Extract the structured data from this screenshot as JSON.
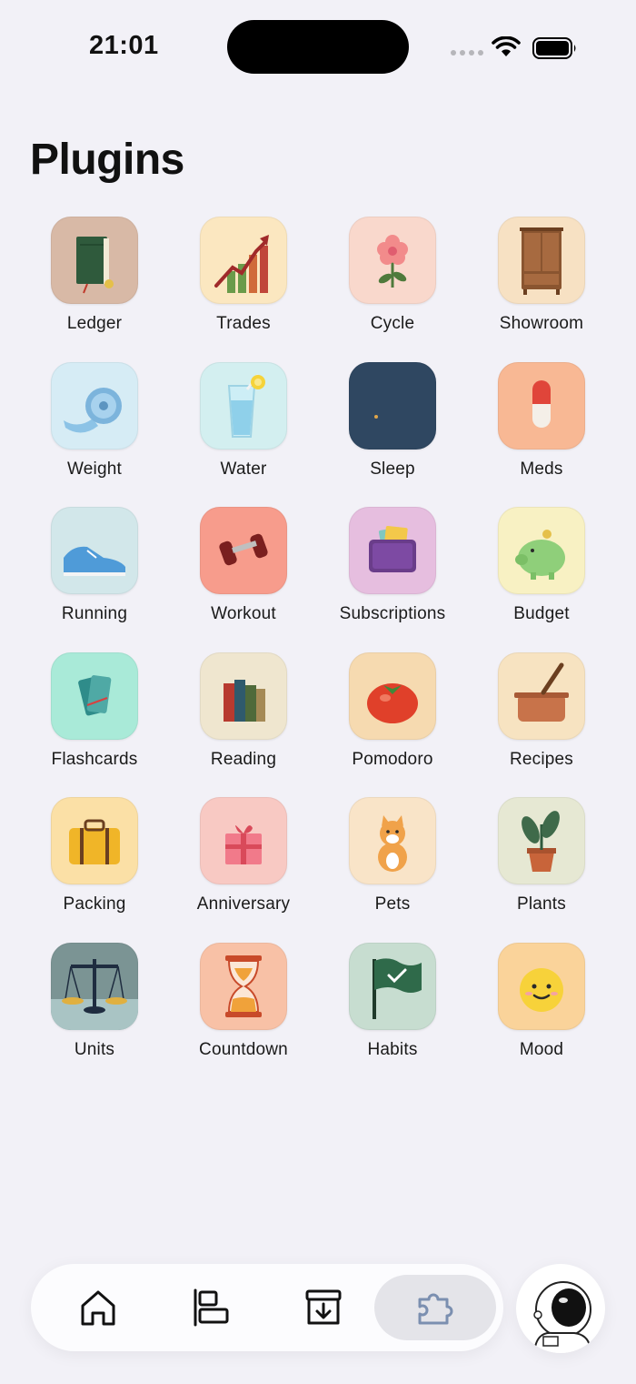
{
  "status": {
    "time": "21:01"
  },
  "page": {
    "title": "Plugins"
  },
  "plugins": [
    {
      "label": "Ledger",
      "icon": "book-icon",
      "bg": "#d8b9a6"
    },
    {
      "label": "Trades",
      "icon": "chart-arrow-icon",
      "bg": "#fbe7c0"
    },
    {
      "label": "Cycle",
      "icon": "flower-icon",
      "bg": "#f9d8cc"
    },
    {
      "label": "Showroom",
      "icon": "wardrobe-icon",
      "bg": "#f7e1c3"
    },
    {
      "label": "Weight",
      "icon": "tape-measure-icon",
      "bg": "#d6ecf5"
    },
    {
      "label": "Water",
      "icon": "water-glass-icon",
      "bg": "#d3eff0"
    },
    {
      "label": "Sleep",
      "icon": "moon-icon",
      "bg": "#2f4761"
    },
    {
      "label": "Meds",
      "icon": "pill-icon",
      "bg": "#f8b894"
    },
    {
      "label": "Running",
      "icon": "sneaker-icon",
      "bg": "#d2e7ea"
    },
    {
      "label": "Workout",
      "icon": "dumbbell-icon",
      "bg": "#f79c8c"
    },
    {
      "label": "Subscriptions",
      "icon": "wallet-icon",
      "bg": "#e6bedf"
    },
    {
      "label": "Budget",
      "icon": "piggy-bank-icon",
      "bg": "#f8f1c3"
    },
    {
      "label": "Flashcards",
      "icon": "cards-icon",
      "bg": "#a9ead8"
    },
    {
      "label": "Reading",
      "icon": "books-icon",
      "bg": "#efe6cf"
    },
    {
      "label": "Pomodoro",
      "icon": "tomato-icon",
      "bg": "#f6dab0"
    },
    {
      "label": "Recipes",
      "icon": "pot-icon",
      "bg": "#f7e3c1"
    },
    {
      "label": "Packing",
      "icon": "suitcase-icon",
      "bg": "#fbe0a6"
    },
    {
      "label": "Anniversary",
      "icon": "gift-icon",
      "bg": "#f8c9c3"
    },
    {
      "label": "Pets",
      "icon": "cat-icon",
      "bg": "#f9e4c8"
    },
    {
      "label": "Plants",
      "icon": "potted-plant-icon",
      "bg": "#e6e8d3"
    },
    {
      "label": "Units",
      "icon": "scales-icon",
      "bg": "#7b9494"
    },
    {
      "label": "Countdown",
      "icon": "hourglass-icon",
      "bg": "#f8c1a6"
    },
    {
      "label": "Habits",
      "icon": "flag-check-icon",
      "bg": "#c7ddd0"
    },
    {
      "label": "Mood",
      "icon": "smiley-icon",
      "bg": "#fad39a"
    }
  ],
  "tabbar": {
    "tabs": [
      {
        "name": "home",
        "icon": "home-icon"
      },
      {
        "name": "timeline",
        "icon": "timeline-icon"
      },
      {
        "name": "inbox",
        "icon": "inbox-download-icon"
      },
      {
        "name": "plugins",
        "icon": "puzzle-icon",
        "active": true
      }
    ],
    "accent": "#7b8fb0"
  },
  "profile": {
    "icon": "astronaut-avatar-icon"
  }
}
